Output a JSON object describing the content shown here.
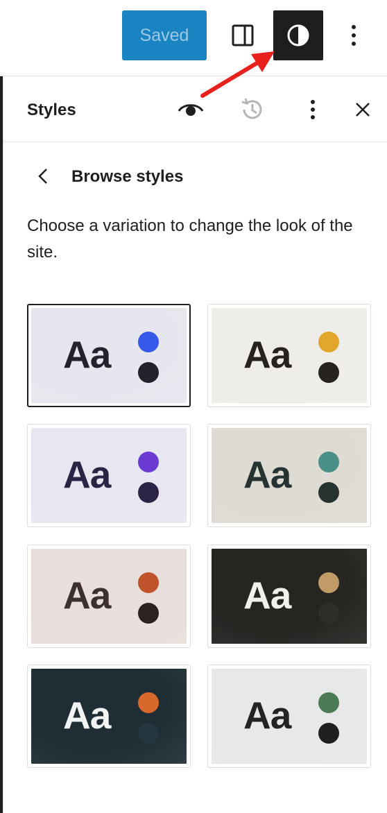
{
  "toolbar": {
    "saved_label": "Saved",
    "icons": [
      "panel-toggle-icon",
      "styles-contrast-icon",
      "more-vertical-icon"
    ]
  },
  "sidebar": {
    "title": "Styles",
    "header_icons": [
      "eye-icon",
      "revisions-icon",
      "more-vertical-icon",
      "close-icon"
    ]
  },
  "browse": {
    "title": "Browse styles",
    "description": "Choose a variation to change the look of the site."
  },
  "variations": [
    {
      "sample": "Aa",
      "selected": true,
      "bg": "#e6e7ee",
      "text": "#23242b",
      "accent1": "#3858e9",
      "accent2": "#23242b"
    },
    {
      "sample": "Aa",
      "selected": false,
      "bg": "#eeede7",
      "text": "#26231f",
      "accent1": "#e3a62c",
      "accent2": "#26231f"
    },
    {
      "sample": "Aa",
      "selected": false,
      "bg": "#e7e6f1",
      "text": "#2c2444",
      "accent1": "#6a3ad2",
      "accent2": "#2c2444"
    },
    {
      "sample": "Aa",
      "selected": false,
      "bg": "#dedbd2",
      "text": "#263330",
      "accent1": "#4b9088",
      "accent2": "#263330"
    },
    {
      "sample": "Aa",
      "selected": false,
      "bg": "#e8dfdc",
      "text": "#3d3130",
      "accent1": "#c1532c",
      "accent2": "#2e2220"
    },
    {
      "sample": "Aa",
      "selected": false,
      "bg": "#262522",
      "text": "#f2f0ea",
      "accent1": "#c09a67",
      "accent2": "#2f2d29"
    },
    {
      "sample": "Aa",
      "selected": false,
      "bg": "#1f2d35",
      "text": "#f2f3f3",
      "accent1": "#d8692c",
      "accent2": "#24363f"
    },
    {
      "sample": "Aa",
      "selected": false,
      "bg": "#e7e8e8",
      "text": "#232323",
      "accent1": "#4b7a57",
      "accent2": "#1f1f1f"
    }
  ],
  "colors": {
    "primary_button": "#1a83c2",
    "dark_surface": "#1e1e1e",
    "annotation_arrow": "#e8211c"
  }
}
